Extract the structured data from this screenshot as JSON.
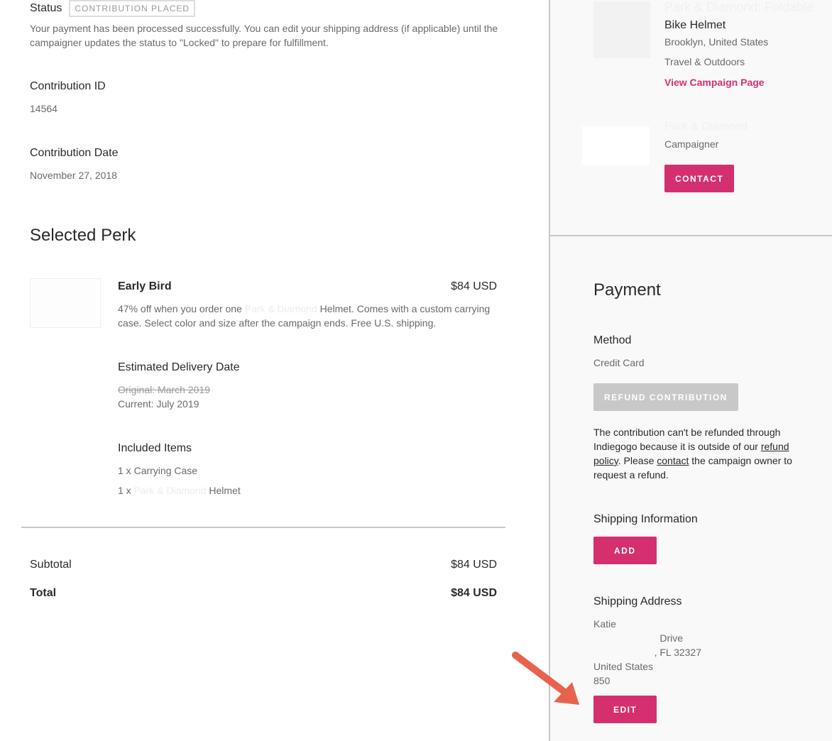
{
  "status": {
    "label": "Status",
    "badge": "CONTRIBUTION PLACED",
    "description": "Your payment has been processed successfully. You can edit your shipping address (if applicable) until the campaigner updates the status to \"Locked\" to prepare for fulfillment."
  },
  "contribution": {
    "id_label": "Contribution ID",
    "id_value": "14564",
    "date_label": "Contribution Date",
    "date_value": "November 27, 2018"
  },
  "perk": {
    "section_title": "Selected Perk",
    "name": "Early Bird",
    "price": "$84 USD",
    "description_prefix": "47% off when you order one ",
    "description_brand": "Park & Diamond",
    "description_suffix": " Helmet. Comes with a custom carrying case. Select color and size after the campaign ends. Free U.S. shipping.",
    "delivery_label": "Estimated Delivery Date",
    "delivery_original": "Original: March 2019",
    "delivery_current": "Current: July 2019",
    "items_label": "Included Items",
    "items": [
      {
        "qty": "1 x",
        "name": "Carrying Case",
        "brand": ""
      },
      {
        "qty": "1 x",
        "name": "Helmet",
        "brand": "Park & Diamond"
      }
    ]
  },
  "totals": {
    "subtotal_label": "Subtotal",
    "subtotal_value": "$84 USD",
    "total_label": "Total",
    "total_value": "$84 USD"
  },
  "campaign": {
    "title_line1": "Park & Diamond: Foldable",
    "title_line2": "Bike Helmet",
    "location": "Brooklyn, United States",
    "category": "Travel & Outdoors",
    "link_label": "View Campaign Page",
    "campaigner_name": "Park & Diamond",
    "campaigner_role": "Campaigner",
    "contact_button": "CONTACT"
  },
  "payment": {
    "title": "Payment",
    "method_label": "Method",
    "method_value": "Credit Card",
    "refund_button": "REFUND CONTRIBUTION",
    "refund_note_1": "The contribution can't be refunded through Indiegogo because it is outside of our ",
    "refund_policy_link": "refund policy",
    "refund_note_2": ". Please ",
    "contact_link": "contact",
    "refund_note_3": " the campaign owner to request a refund."
  },
  "shipping": {
    "info_label": "Shipping Information",
    "add_button": "ADD",
    "address_label": "Shipping Address",
    "name_visible": "Katie",
    "street_visible": "Drive",
    "city_visible": ", FL 32327",
    "country": "United States",
    "phone_visible": "850",
    "edit_button": "EDIT"
  },
  "colors": {
    "accent": "#d4306f",
    "disabled": "#c8c8c8",
    "annotation_arrow": "#e8634e"
  }
}
